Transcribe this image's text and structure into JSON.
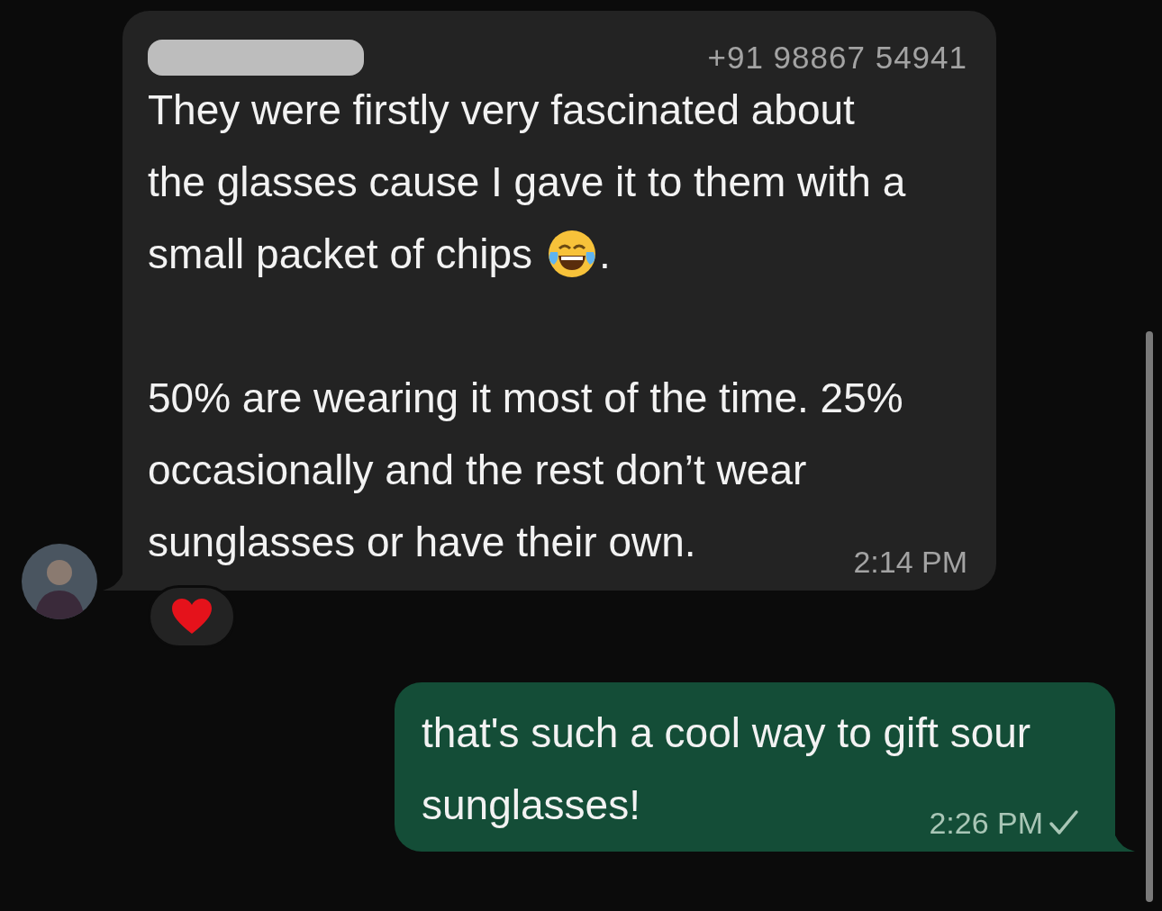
{
  "incoming": {
    "phone": "+91 98867 54941",
    "paragraphs": [
      {
        "lines": [
          {
            "parts": [
              {
                "kind": "text",
                "text": "They were firstly very fascinated about"
              }
            ]
          },
          {
            "parts": [
              {
                "kind": "text",
                "text": "the glasses cause I gave it to them with a"
              }
            ]
          },
          {
            "parts": [
              {
                "kind": "text",
                "text": "small packet of chips"
              },
              {
                "kind": "emoji"
              },
              {
                "kind": "text",
                "text": "."
              }
            ]
          }
        ]
      },
      {
        "lines": [
          {
            "parts": [
              {
                "kind": "text",
                "text": "50% are wearing it most of the time. 25%"
              }
            ]
          },
          {
            "parts": [
              {
                "kind": "text",
                "text": "occasionally and the rest don’t wear"
              }
            ]
          },
          {
            "parts": [
              {
                "kind": "text",
                "text": "sunglasses or have their own."
              }
            ]
          }
        ]
      }
    ],
    "time": "2:14 PM",
    "reaction": {
      "kind": "heart"
    }
  },
  "outgoing": {
    "lines": [
      "that's such a cool way to gift sour",
      "sunglasses!"
    ],
    "time": "2:26 PM",
    "sent": true
  }
}
